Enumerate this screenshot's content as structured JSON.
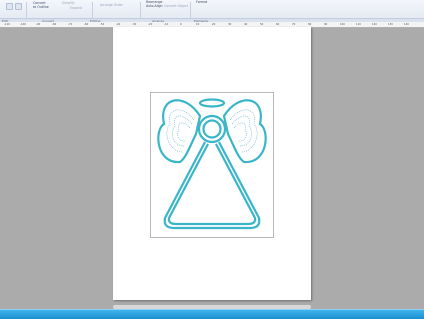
{
  "ribbon": {
    "item1": "Convert",
    "item1b": "to Outline",
    "item2": "Simplify",
    "item3": "Expand",
    "item4": "Arrange Order",
    "item5": "Rearrange",
    "item5b": "Auto-Align",
    "item6": "Convert Object",
    "item7": "Format",
    "groups": [
      "Edit",
      "Convert",
      "Editing",
      "Arrange",
      "Elements"
    ]
  },
  "ruler": {
    "ticks": [
      "-110",
      "-100",
      "-90",
      "-80",
      "-70",
      "-60",
      "-50",
      "-40",
      "-30",
      "-20",
      "-10",
      "0",
      "10",
      "20",
      "30",
      "40",
      "50",
      "60",
      "70",
      "80",
      "90",
      "100",
      "110",
      "120",
      "130",
      "140"
    ]
  },
  "colors": {
    "outline": "#3ab6c8",
    "stitch": "#5aa8c4",
    "status_bar": "#2aa3e0"
  }
}
